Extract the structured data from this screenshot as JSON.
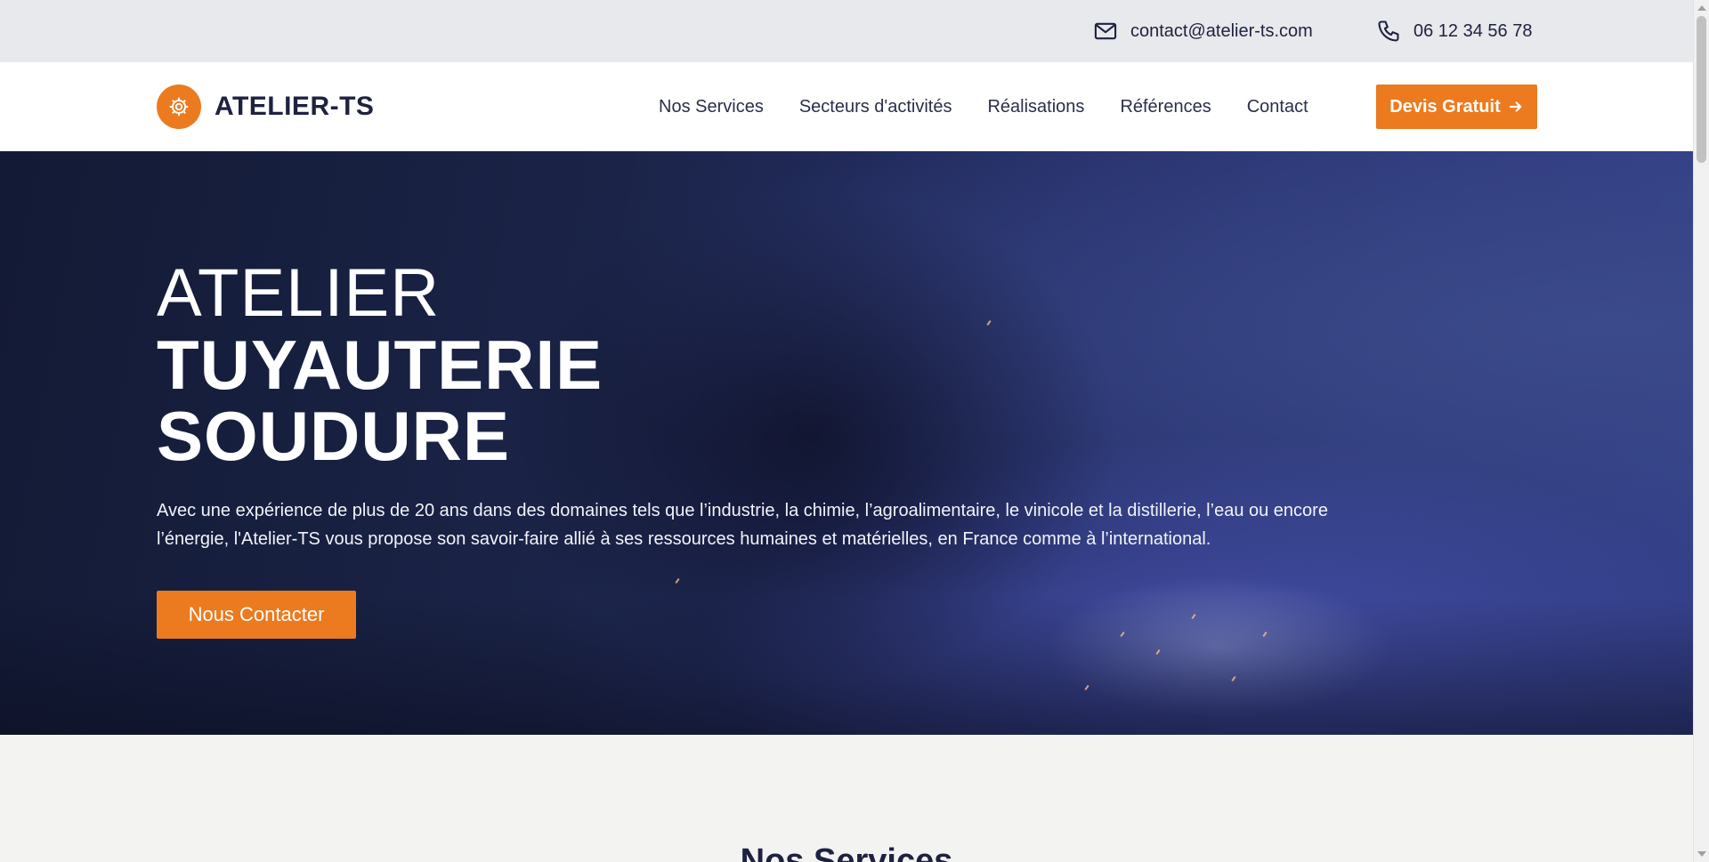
{
  "topbar": {
    "email": "contact@atelier-ts.com",
    "phone": "06 12 34 56 78",
    "email_icon": "mail-icon",
    "phone_icon": "phone-icon"
  },
  "header": {
    "logo_text": "ATELIER-TS",
    "logo_icon": "gear-icon",
    "nav": [
      {
        "label": "Nos Services"
      },
      {
        "label": "Secteurs d'activités"
      },
      {
        "label": "Réalisations"
      },
      {
        "label": "Références"
      },
      {
        "label": "Contact"
      }
    ],
    "cta_label": "Devis Gratuit",
    "cta_icon": "arrow-right-icon"
  },
  "hero": {
    "line1": "ATELIER",
    "line2": "TUYAUTERIE",
    "line3": "SOUDURE",
    "description": "Avec une expérience de plus de 20 ans dans des domaines tels que l’industrie, la chimie, l’agroalimentaire, le vinicole et la distillerie, l’eau ou encore l’énergie, l'Atelier-TS vous propose son savoir-faire allié à ses ressources humaines et matérielles, en France comme à l’international.",
    "button_label": "Nous Contacter"
  },
  "services": {
    "title": "Nos Services"
  },
  "colors": {
    "accent": "#ec7a1f",
    "navy": "#1e2240",
    "topbar_bg": "#e8e9ec"
  }
}
